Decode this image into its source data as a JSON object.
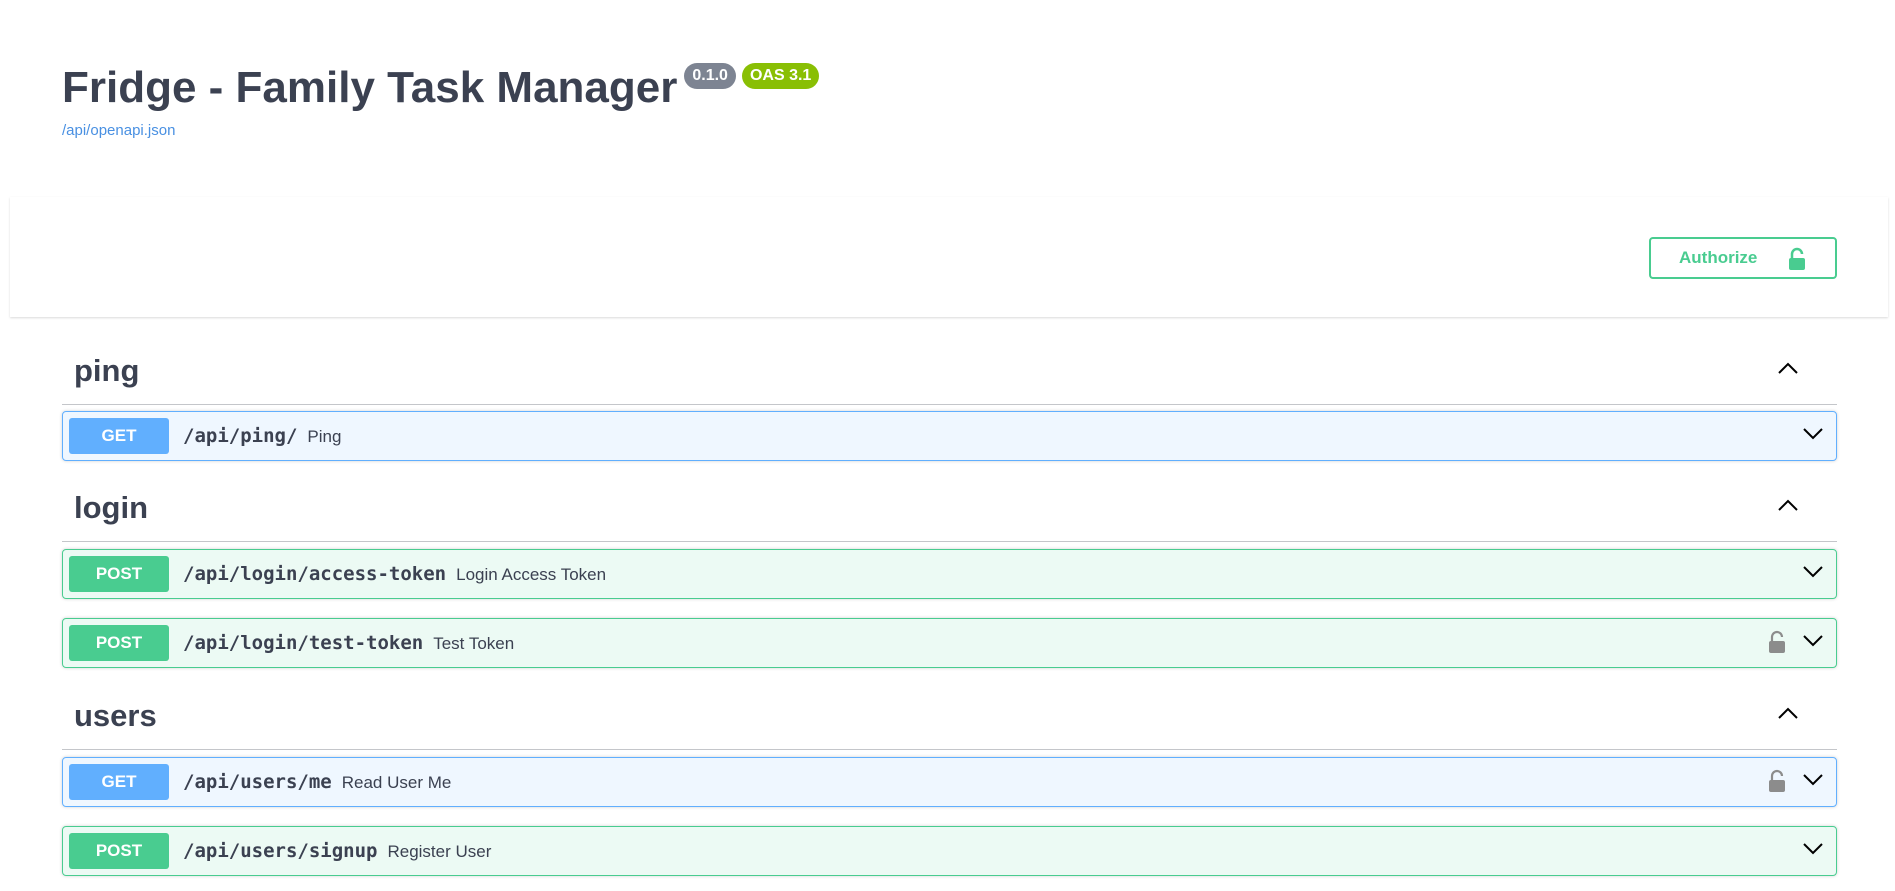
{
  "info": {
    "title": "Fridge - Family Task Manager",
    "version": "0.1.0",
    "oas": "OAS 3.1",
    "spec_url": "/api/openapi.json"
  },
  "authorize": {
    "label": "Authorize",
    "icon": "unlocked-lock-icon"
  },
  "colors": {
    "get": "#61affe",
    "post": "#49cc90",
    "authorize": "#49cc90",
    "badge_version": "#7d8492",
    "badge_oas": "#89bf04",
    "link": "#4990e2"
  },
  "tags": [
    {
      "name": "ping",
      "operations": [
        {
          "method": "GET",
          "path": "/api/ping/",
          "summary": "Ping",
          "locked": false
        }
      ]
    },
    {
      "name": "login",
      "operations": [
        {
          "method": "POST",
          "path": "/api/login/access-token",
          "summary": "Login Access Token",
          "locked": false
        },
        {
          "method": "POST",
          "path": "/api/login/test-token",
          "summary": "Test Token",
          "locked": true
        }
      ]
    },
    {
      "name": "users",
      "operations": [
        {
          "method": "GET",
          "path": "/api/users/me",
          "summary": "Read User Me",
          "locked": true
        },
        {
          "method": "POST",
          "path": "/api/users/signup",
          "summary": "Register User",
          "locked": false
        }
      ]
    }
  ]
}
